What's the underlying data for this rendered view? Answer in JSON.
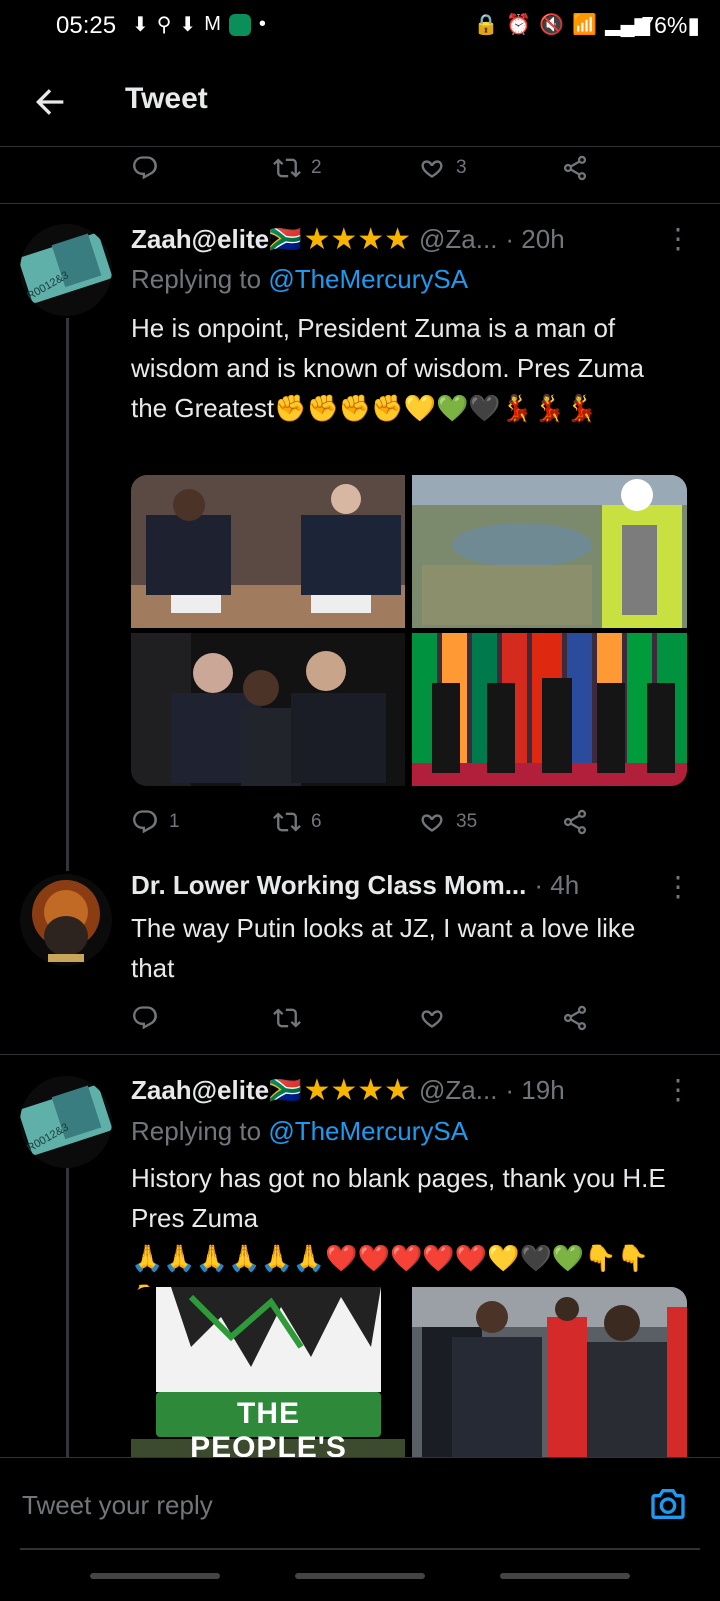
{
  "status_bar": {
    "time": "05:25",
    "left_icons": [
      "download-icon",
      "user-icon",
      "download-icon",
      "gmail-icon",
      "app-icon",
      "dot-icon"
    ],
    "right_icons": [
      "lock-icon",
      "alarm-icon",
      "mute-icon",
      "wifi-icon",
      "signal-icon"
    ],
    "battery": "76%"
  },
  "header": {
    "title": "Tweet"
  },
  "top_actions": {
    "reply_count": "",
    "retweet_count": "2",
    "like_count": "3"
  },
  "tweets": [
    {
      "name": "Zaah@elite",
      "flag": "🇿🇦",
      "stars": "★★★★",
      "handle": "@Za...",
      "time": "· 20h",
      "replying_to_label": "Replying to ",
      "replying_to": "@TheMercurySA",
      "text": "He is onpoint, President Zuma is a man of wisdom and is known of wisdom. Pres Zuma the Greatest",
      "emojis": "✊✊✊✊💛💚🖤💃💃💃",
      "reply_count": "1",
      "retweet_count": "6",
      "like_count": "35"
    },
    {
      "name": "Dr. Lower Working Class Mom...",
      "time": "· 4h",
      "text": "The way Putin looks at JZ, I want a love like that",
      "reply_count": "",
      "retweet_count": "",
      "like_count": ""
    },
    {
      "name": "Zaah@elite",
      "flag": "🇿🇦",
      "stars": "★★★★",
      "handle": "@Za...",
      "time": "· 19h",
      "replying_to_label": "Replying to ",
      "replying_to": "@TheMercurySA",
      "text": "History has got no blank pages, thank you H.E Pres Zuma",
      "emojis": "🙏🙏🙏🙏🙏🙏❤️❤️❤️❤️❤️💛🖤💚👇👇👇",
      "media_text": "THE PEOPLE'S"
    }
  ],
  "reply_bar": {
    "placeholder": "Tweet your reply"
  },
  "colors": {
    "accent": "#1d9bf0",
    "muted": "#71767b",
    "divider": "#2f3336",
    "star": "#f7b500"
  }
}
